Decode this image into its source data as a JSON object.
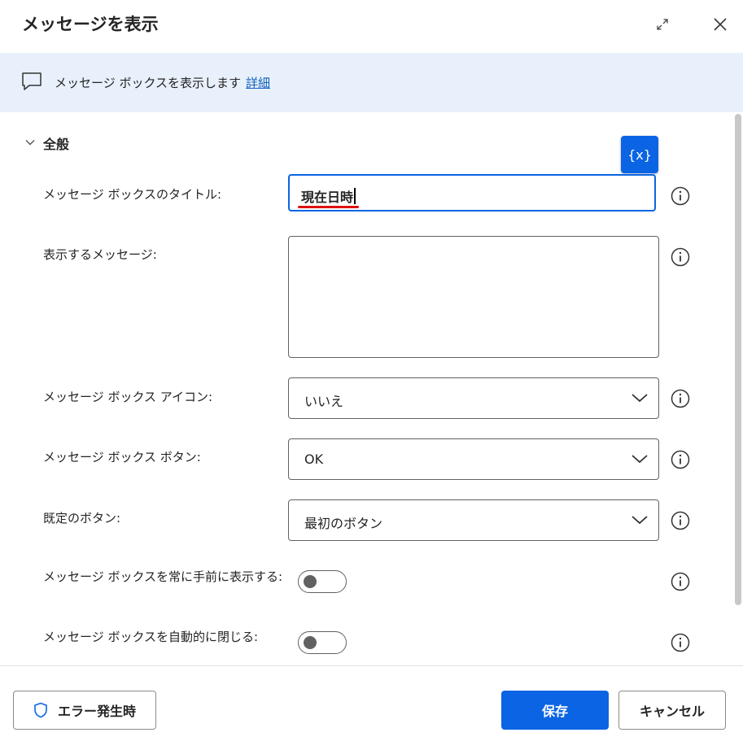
{
  "dialog": {
    "title": "メッセージを表示"
  },
  "banner": {
    "text": "メッセージ ボックスを表示します",
    "link": "詳細"
  },
  "section": {
    "title": "全般"
  },
  "variable_button": {
    "label": "{x}"
  },
  "fields": {
    "title_label": "メッセージ ボックスのタイトル:",
    "title_value": "現在日時",
    "message_label": "表示するメッセージ:",
    "message_value": "",
    "icon_label": "メッセージ ボックス アイコン:",
    "icon_value": "いいえ",
    "buttons_label": "メッセージ ボックス ボタン:",
    "buttons_value": "OK",
    "default_button_label": "既定のボタン:",
    "default_button_value": "最初のボタン",
    "always_on_top_label": "メッセージ ボックスを常に手前に表示する:",
    "always_on_top_on": false,
    "auto_close_label": "メッセージ ボックスを自動的に閉じる:",
    "auto_close_on": false
  },
  "footer": {
    "error_button": "エラー発生時",
    "save_button": "保存",
    "cancel_button": "キャンセル"
  },
  "colors": {
    "accent": "#0a64e4",
    "banner_bg": "#e8f1fb",
    "link": "#0f5fbf",
    "spellcheck_underline": "#e01010"
  },
  "icons": {
    "expand": "expand-icon",
    "close": "close-icon",
    "banner": "speech-bubble-icon",
    "section_toggle": "chevron-down-icon",
    "info": "info-icon",
    "dropdown": "chevron-down-icon",
    "error_button": "shield-icon"
  }
}
